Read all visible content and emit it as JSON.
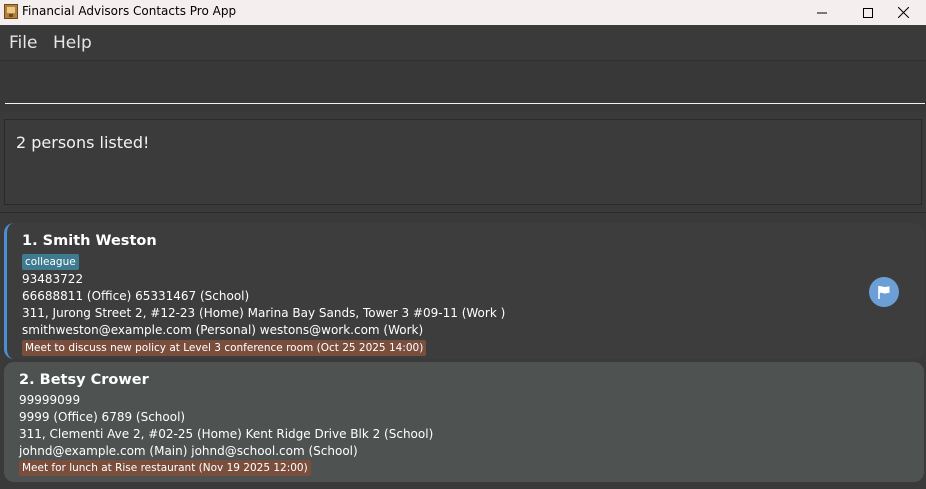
{
  "window": {
    "title": "Financial Advisors Contacts Pro App",
    "icon": "app-book-icon",
    "controls": [
      "minimize-icon",
      "maximize-icon",
      "close-icon"
    ]
  },
  "menu": {
    "file": "File",
    "help": "Help"
  },
  "command": {
    "value": "",
    "placeholder": ""
  },
  "result": {
    "message": "2 persons listed!"
  },
  "persons": [
    {
      "index": "1.",
      "name": "Smith Weston",
      "tag": "colleague",
      "phone": "93483722",
      "other_phones": "66688811 (Office) 65331467 (School)",
      "address": "311, Jurong Street 2, #12-23 (Home) Marina Bay Sands, Tower 3 #09-11 (Work )",
      "emails": "smithweston@example.com (Personal) westons@work.com (Work)",
      "appointment": "Meet to discuss new policy at Level 3 conference room (Oct 25 2025 14:00)",
      "flag_icon": "flag-icon",
      "selected": true
    },
    {
      "index": "2.",
      "name": "Betsy Crower",
      "phone": "99999099",
      "other_phones": "9999 (Office) 6789 (School)",
      "address": "311, Clementi Ave 2, #02-25 (Home) Kent Ridge Drive Blk 2 (School)",
      "emails": "johnd@example.com (Main) johnd@school.com (School)",
      "appointment": "Meet for lunch at Rise restaurant (Nov 19 2025 12:00)",
      "selected": false
    }
  ],
  "colors": {
    "background": "#3a3a3a",
    "selected_card": "#3d3d3d",
    "card": "#4e5352",
    "selection_accent": "#4a8ed8",
    "tag": "#3e7b91",
    "appointment": "#7a4e3c",
    "flag_button": "#6b9fd6"
  }
}
